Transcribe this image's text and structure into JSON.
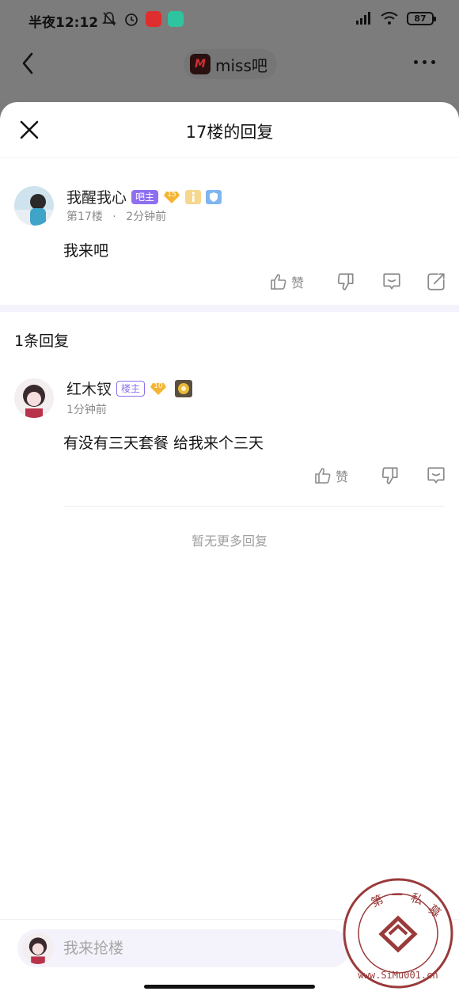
{
  "status_bar": {
    "time": "半夜12:12",
    "battery": "87"
  },
  "nav": {
    "forum_name": "miss吧",
    "forum_logo_text": "M"
  },
  "sheet": {
    "title": "17楼的回复"
  },
  "post": {
    "user_name": "我醒我心",
    "owner_tag": "吧主",
    "level": "15",
    "floor": "第17楼",
    "dot": "·",
    "time": "2分钟前",
    "content": "我来吧",
    "like_label": "赞"
  },
  "replies_header": "1条回复",
  "reply": {
    "user_name": "红木钗",
    "floor_tag": "楼主",
    "level": "10",
    "time": "1分钟前",
    "content": "有没有三天套餐 给我来个三天",
    "like_label": "赞"
  },
  "no_more_text": "暂无更多回复",
  "input": {
    "placeholder": "我来抢楼"
  },
  "watermark": {
    "top_text": "第一私募",
    "bottom_text": "www.SiMu001.cn"
  },
  "colors": {
    "accent": "#8e6ff0",
    "muted": "#8a8a8a",
    "band": "#f4f3fb"
  }
}
